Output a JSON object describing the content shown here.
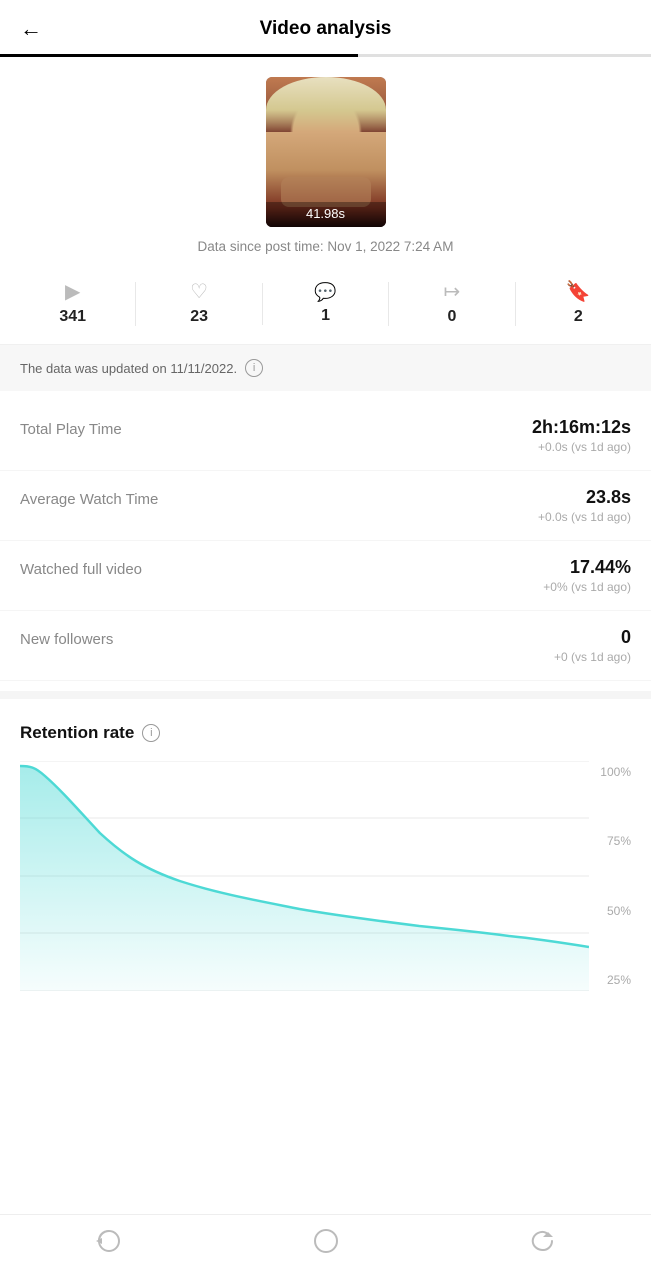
{
  "header": {
    "back_label": "←",
    "title": "Video analysis"
  },
  "thumbnail": {
    "duration": "41.98s",
    "data_since": "Data since post time: Nov 1, 2022 7:24 AM"
  },
  "stats": [
    {
      "icon": "▶",
      "value": "341",
      "name": "plays"
    },
    {
      "icon": "♡",
      "value": "23",
      "name": "likes"
    },
    {
      "icon": "💬",
      "value": "1",
      "name": "comments"
    },
    {
      "icon": "➦",
      "value": "0",
      "name": "shares"
    },
    {
      "icon": "🔖",
      "value": "2",
      "name": "bookmarks"
    }
  ],
  "update_notice": {
    "text": "The data was updated on 11/11/2022.",
    "icon": "i"
  },
  "metrics": [
    {
      "label": "Total Play Time",
      "main": "2h:16m:12s",
      "sub": "+0.0s (vs 1d ago)"
    },
    {
      "label": "Average Watch Time",
      "main": "23.8s",
      "sub": "+0.0s (vs 1d ago)"
    },
    {
      "label": "Watched full video",
      "main": "17.44%",
      "sub": "+0% (vs 1d ago)"
    },
    {
      "label": "New followers",
      "main": "0",
      "sub": "+0 (vs 1d ago)"
    }
  ],
  "retention": {
    "title": "Retention rate",
    "info_icon": "i",
    "y_labels": [
      "100%",
      "75%",
      "50%",
      "25%"
    ],
    "chart_color": "#4dd9d5",
    "chart_fill": "rgba(77,217,213,0.25)"
  },
  "bottom_nav": [
    {
      "icon": "⟳",
      "name": "profile-icon"
    },
    {
      "icon": "○",
      "name": "home-icon"
    },
    {
      "icon": "↺",
      "name": "refresh-icon"
    }
  ]
}
